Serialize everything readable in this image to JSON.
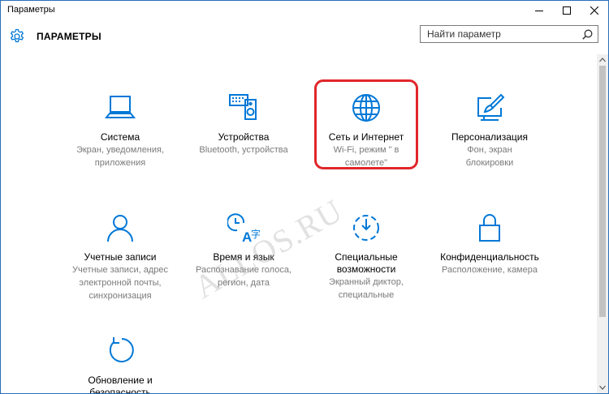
{
  "window": {
    "title": "Параметры",
    "controls": [
      "minimize-icon",
      "maximize-icon",
      "close-icon"
    ]
  },
  "header": {
    "app_title": "ПАРАМЕТРЫ",
    "search_placeholder": "Найти параметр"
  },
  "accent_color": "#0078d7",
  "highlight_color": "#e0272b",
  "watermark": "ALLOS.RU",
  "tiles": [
    {
      "icon": "laptop-icon",
      "title": "Система",
      "desc": [
        "Экран, уведомления,",
        "приложения"
      ]
    },
    {
      "icon": "keyboard-speaker-icon",
      "title": "Устройства",
      "desc": [
        "Bluetooth, устройства"
      ]
    },
    {
      "icon": "globe-icon",
      "title": "Сеть и Интернет",
      "desc": [
        "Wi-Fi, режим \" в",
        "самолете\""
      ]
    },
    {
      "icon": "paint-monitor-icon",
      "title": "Персонализация",
      "desc": [
        "Фон, экран",
        "блокировки"
      ]
    },
    {
      "icon": "person-icon",
      "title": "Учетные записи",
      "desc": [
        "Учетные записи, адрес",
        "электронной почты,",
        "синхронизация"
      ]
    },
    {
      "icon": "clock-language-icon",
      "title": "Время и язык",
      "desc": [
        "Распознавание голоса,",
        "регион, дата"
      ]
    },
    {
      "icon": "accessibility-icon",
      "title": "Специальные возможности",
      "desc": [
        "Экранный диктор,",
        "специальные"
      ]
    },
    {
      "icon": "lock-icon",
      "title": "Конфиденциальность",
      "desc": [
        "Расположение, камера"
      ]
    },
    {
      "icon": "update-icon",
      "title": "Обновление и безопасность",
      "desc": []
    }
  ]
}
